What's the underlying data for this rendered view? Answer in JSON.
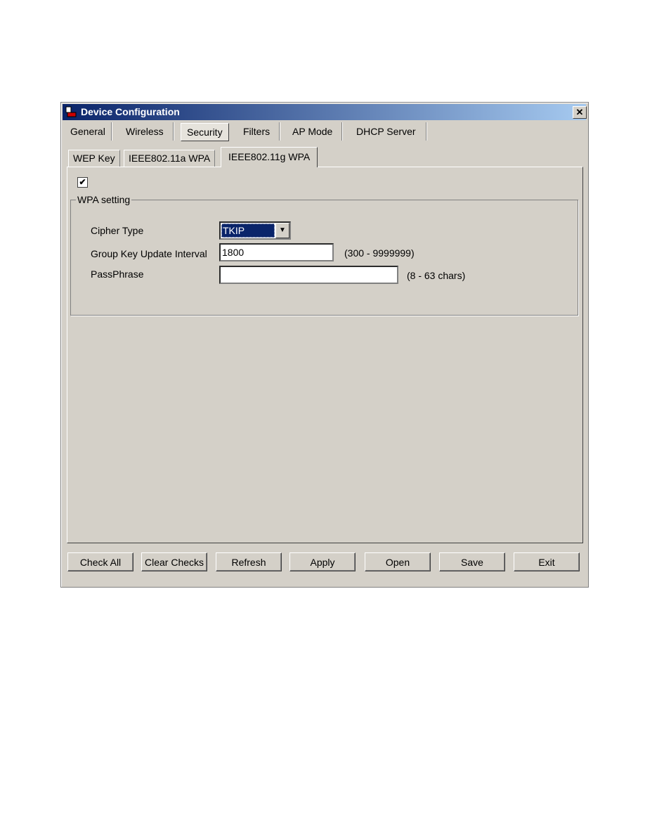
{
  "window": {
    "title": "Device Configuration",
    "close_label": "✕"
  },
  "tabs": [
    {
      "label": "General"
    },
    {
      "label": "Wireless"
    },
    {
      "label": "Security",
      "selected": true
    },
    {
      "label": "Filters"
    },
    {
      "label": "AP Mode"
    },
    {
      "label": "DHCP Server"
    }
  ],
  "subtabs": [
    {
      "label": "WEP Key"
    },
    {
      "label": "IEEE802.11a WPA"
    },
    {
      "label": "IEEE802.11g WPA",
      "selected": true
    }
  ],
  "enable_checkbox": {
    "checked": true,
    "mark": "✔"
  },
  "wpa": {
    "group_label": "WPA setting",
    "cipher_label": "Cipher Type",
    "cipher_value": "TKIP",
    "interval_label": "Group Key Update Interval",
    "interval_value": "1800",
    "interval_hint": "(300 - 9999999)",
    "pass_label": "PassPhrase",
    "pass_value": "",
    "pass_hint": "(8 - 63 chars)"
  },
  "buttons": [
    {
      "label": "Check All"
    },
    {
      "label": "Clear Checks"
    },
    {
      "label": "Refresh"
    },
    {
      "label": "Apply"
    },
    {
      "label": "Open"
    },
    {
      "label": "Save"
    },
    {
      "label": "Exit"
    }
  ]
}
